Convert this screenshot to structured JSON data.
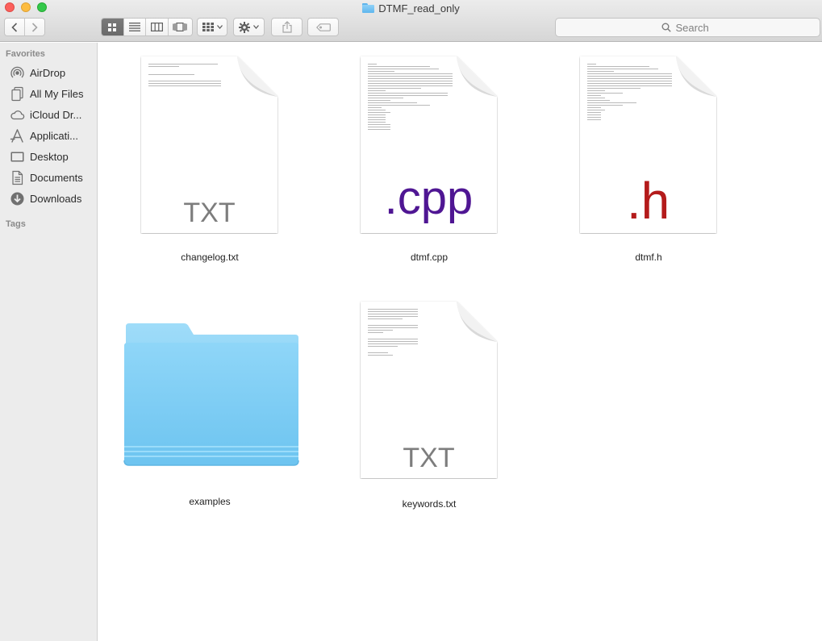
{
  "window": {
    "title": "DTMF_read_only"
  },
  "toolbar": {
    "back_icon": "chevron-left-icon",
    "forward_icon": "chevron-right-icon",
    "view_modes": [
      "icon-view",
      "list-view",
      "column-view",
      "cover-flow-view"
    ],
    "active_view": "icon-view",
    "search_placeholder": "Search"
  },
  "sidebar": {
    "favorites_heading": "Favorites",
    "tags_heading": "Tags",
    "items": [
      {
        "label": "AirDrop",
        "icon": "airdrop-icon"
      },
      {
        "label": "All My Files",
        "icon": "all-files-icon"
      },
      {
        "label": "iCloud Dr...",
        "icon": "icloud-icon"
      },
      {
        "label": "Applicati...",
        "icon": "applications-icon"
      },
      {
        "label": "Desktop",
        "icon": "desktop-icon"
      },
      {
        "label": "Documents",
        "icon": "documents-icon"
      },
      {
        "label": "Downloads",
        "icon": "downloads-icon"
      }
    ]
  },
  "files": [
    {
      "name": "changelog.txt",
      "kind": "document",
      "badge": "TXT",
      "badge_color": "#7d7d7d"
    },
    {
      "name": "dtmf.cpp",
      "kind": "document",
      "badge": ".cpp",
      "badge_color": "#4f1693"
    },
    {
      "name": "dtmf.h",
      "kind": "document",
      "badge": ".h",
      "badge_color": "#b41b1b"
    },
    {
      "name": "examples",
      "kind": "folder",
      "badge": "",
      "badge_color": "#6ccdf6"
    },
    {
      "name": "keywords.txt",
      "kind": "document",
      "badge": "TXT",
      "badge_color": "#7d7d7d"
    }
  ]
}
